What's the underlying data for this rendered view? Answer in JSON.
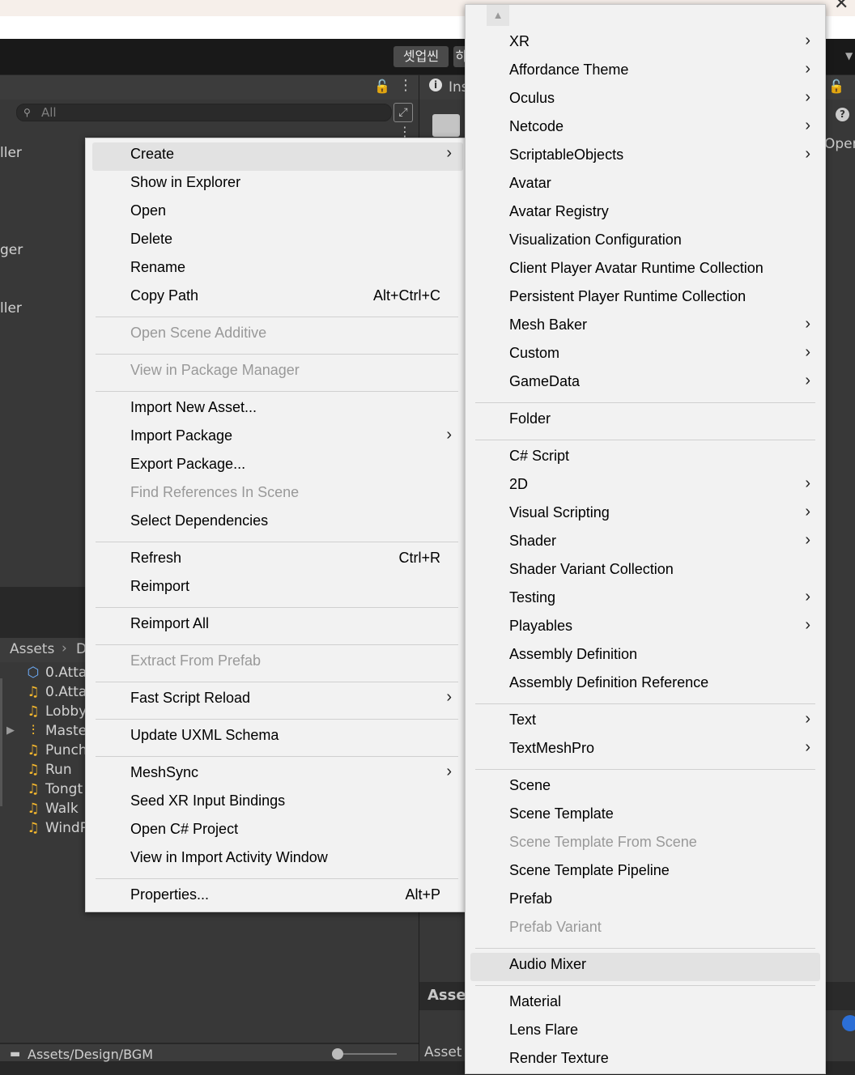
{
  "toolbar": {
    "btn1": "셋업씬",
    "btn2": "하"
  },
  "project": {
    "search_placeholder": "All",
    "hierarchy_fragments": [
      "ller",
      "ger",
      "ller"
    ],
    "breadcrumb": {
      "root": "Assets",
      "next": "D"
    },
    "assets": [
      {
        "icon": "prefab-icon",
        "name": "0.Atta"
      },
      {
        "icon": "audio-icon",
        "name": "0.Atta"
      },
      {
        "icon": "audio-icon",
        "name": "Lobby"
      },
      {
        "icon": "mixer-icon",
        "name": "Maste"
      },
      {
        "icon": "audio-icon",
        "name": "Punch"
      },
      {
        "icon": "audio-icon",
        "name": "Run"
      },
      {
        "icon": "audio-icon",
        "name": "Tongt"
      },
      {
        "icon": "audio-icon",
        "name": "Walk"
      },
      {
        "icon": "audio-icon",
        "name": "WindP"
      }
    ],
    "path": "Assets/Design/BGM"
  },
  "inspector": {
    "tab": "Ins",
    "open_btn": "Oper",
    "asse_label": "Asse",
    "asset_label": "Asset"
  },
  "menu_left": {
    "items": [
      {
        "label": "Create",
        "submenu": true,
        "highlight": true
      },
      {
        "label": "Show in Explorer"
      },
      {
        "label": "Open"
      },
      {
        "label": "Delete"
      },
      {
        "label": "Rename"
      },
      {
        "label": "Copy Path",
        "shortcut": "Alt+Ctrl+C"
      },
      {
        "sep": true
      },
      {
        "label": "Open Scene Additive",
        "disabled": true
      },
      {
        "sep": true
      },
      {
        "label": "View in Package Manager",
        "disabled": true
      },
      {
        "sep": true
      },
      {
        "label": "Import New Asset..."
      },
      {
        "label": "Import Package",
        "submenu": true
      },
      {
        "label": "Export Package..."
      },
      {
        "label": "Find References In Scene",
        "disabled": true
      },
      {
        "label": "Select Dependencies"
      },
      {
        "sep": true
      },
      {
        "label": "Refresh",
        "shortcut": "Ctrl+R"
      },
      {
        "label": "Reimport"
      },
      {
        "sep": true
      },
      {
        "label": "Reimport All"
      },
      {
        "sep": true
      },
      {
        "label": "Extract From Prefab",
        "disabled": true
      },
      {
        "sep": true
      },
      {
        "label": "Fast Script Reload",
        "submenu": true
      },
      {
        "sep": true
      },
      {
        "label": "Update UXML Schema"
      },
      {
        "sep": true
      },
      {
        "label": "MeshSync",
        "submenu": true
      },
      {
        "label": "Seed XR Input Bindings"
      },
      {
        "label": "Open C# Project"
      },
      {
        "label": "View in Import Activity Window"
      },
      {
        "sep": true
      },
      {
        "label": "Properties...",
        "shortcut": "Alt+P"
      }
    ]
  },
  "menu_right": {
    "items": [
      {
        "label": "XR",
        "submenu": true
      },
      {
        "label": "Affordance Theme",
        "submenu": true
      },
      {
        "label": "Oculus",
        "submenu": true
      },
      {
        "label": "Netcode",
        "submenu": true
      },
      {
        "label": "ScriptableObjects",
        "submenu": true
      },
      {
        "label": "Avatar"
      },
      {
        "label": "Avatar Registry"
      },
      {
        "label": "Visualization Configuration"
      },
      {
        "label": "Client Player Avatar Runtime Collection"
      },
      {
        "label": "Persistent Player Runtime Collection"
      },
      {
        "label": "Mesh Baker",
        "submenu": true
      },
      {
        "label": "Custom",
        "submenu": true
      },
      {
        "label": "GameData",
        "submenu": true
      },
      {
        "sep": true
      },
      {
        "label": "Folder"
      },
      {
        "sep": true
      },
      {
        "label": "C# Script"
      },
      {
        "label": "2D",
        "submenu": true
      },
      {
        "label": "Visual Scripting",
        "submenu": true
      },
      {
        "label": "Shader",
        "submenu": true
      },
      {
        "label": "Shader Variant Collection"
      },
      {
        "label": "Testing",
        "submenu": true
      },
      {
        "label": "Playables",
        "submenu": true
      },
      {
        "label": "Assembly Definition"
      },
      {
        "label": "Assembly Definition Reference"
      },
      {
        "sep": true
      },
      {
        "label": "Text",
        "submenu": true
      },
      {
        "label": "TextMeshPro",
        "submenu": true
      },
      {
        "sep": true
      },
      {
        "label": "Scene"
      },
      {
        "label": "Scene Template"
      },
      {
        "label": "Scene Template From Scene",
        "disabled": true
      },
      {
        "label": "Scene Template Pipeline"
      },
      {
        "label": "Prefab"
      },
      {
        "label": "Prefab Variant",
        "disabled": true
      },
      {
        "sep": true
      },
      {
        "label": "Audio Mixer",
        "highlight": true
      },
      {
        "sep": true
      },
      {
        "label": "Material"
      },
      {
        "label": "Lens Flare"
      },
      {
        "label": "Render Texture"
      }
    ]
  }
}
